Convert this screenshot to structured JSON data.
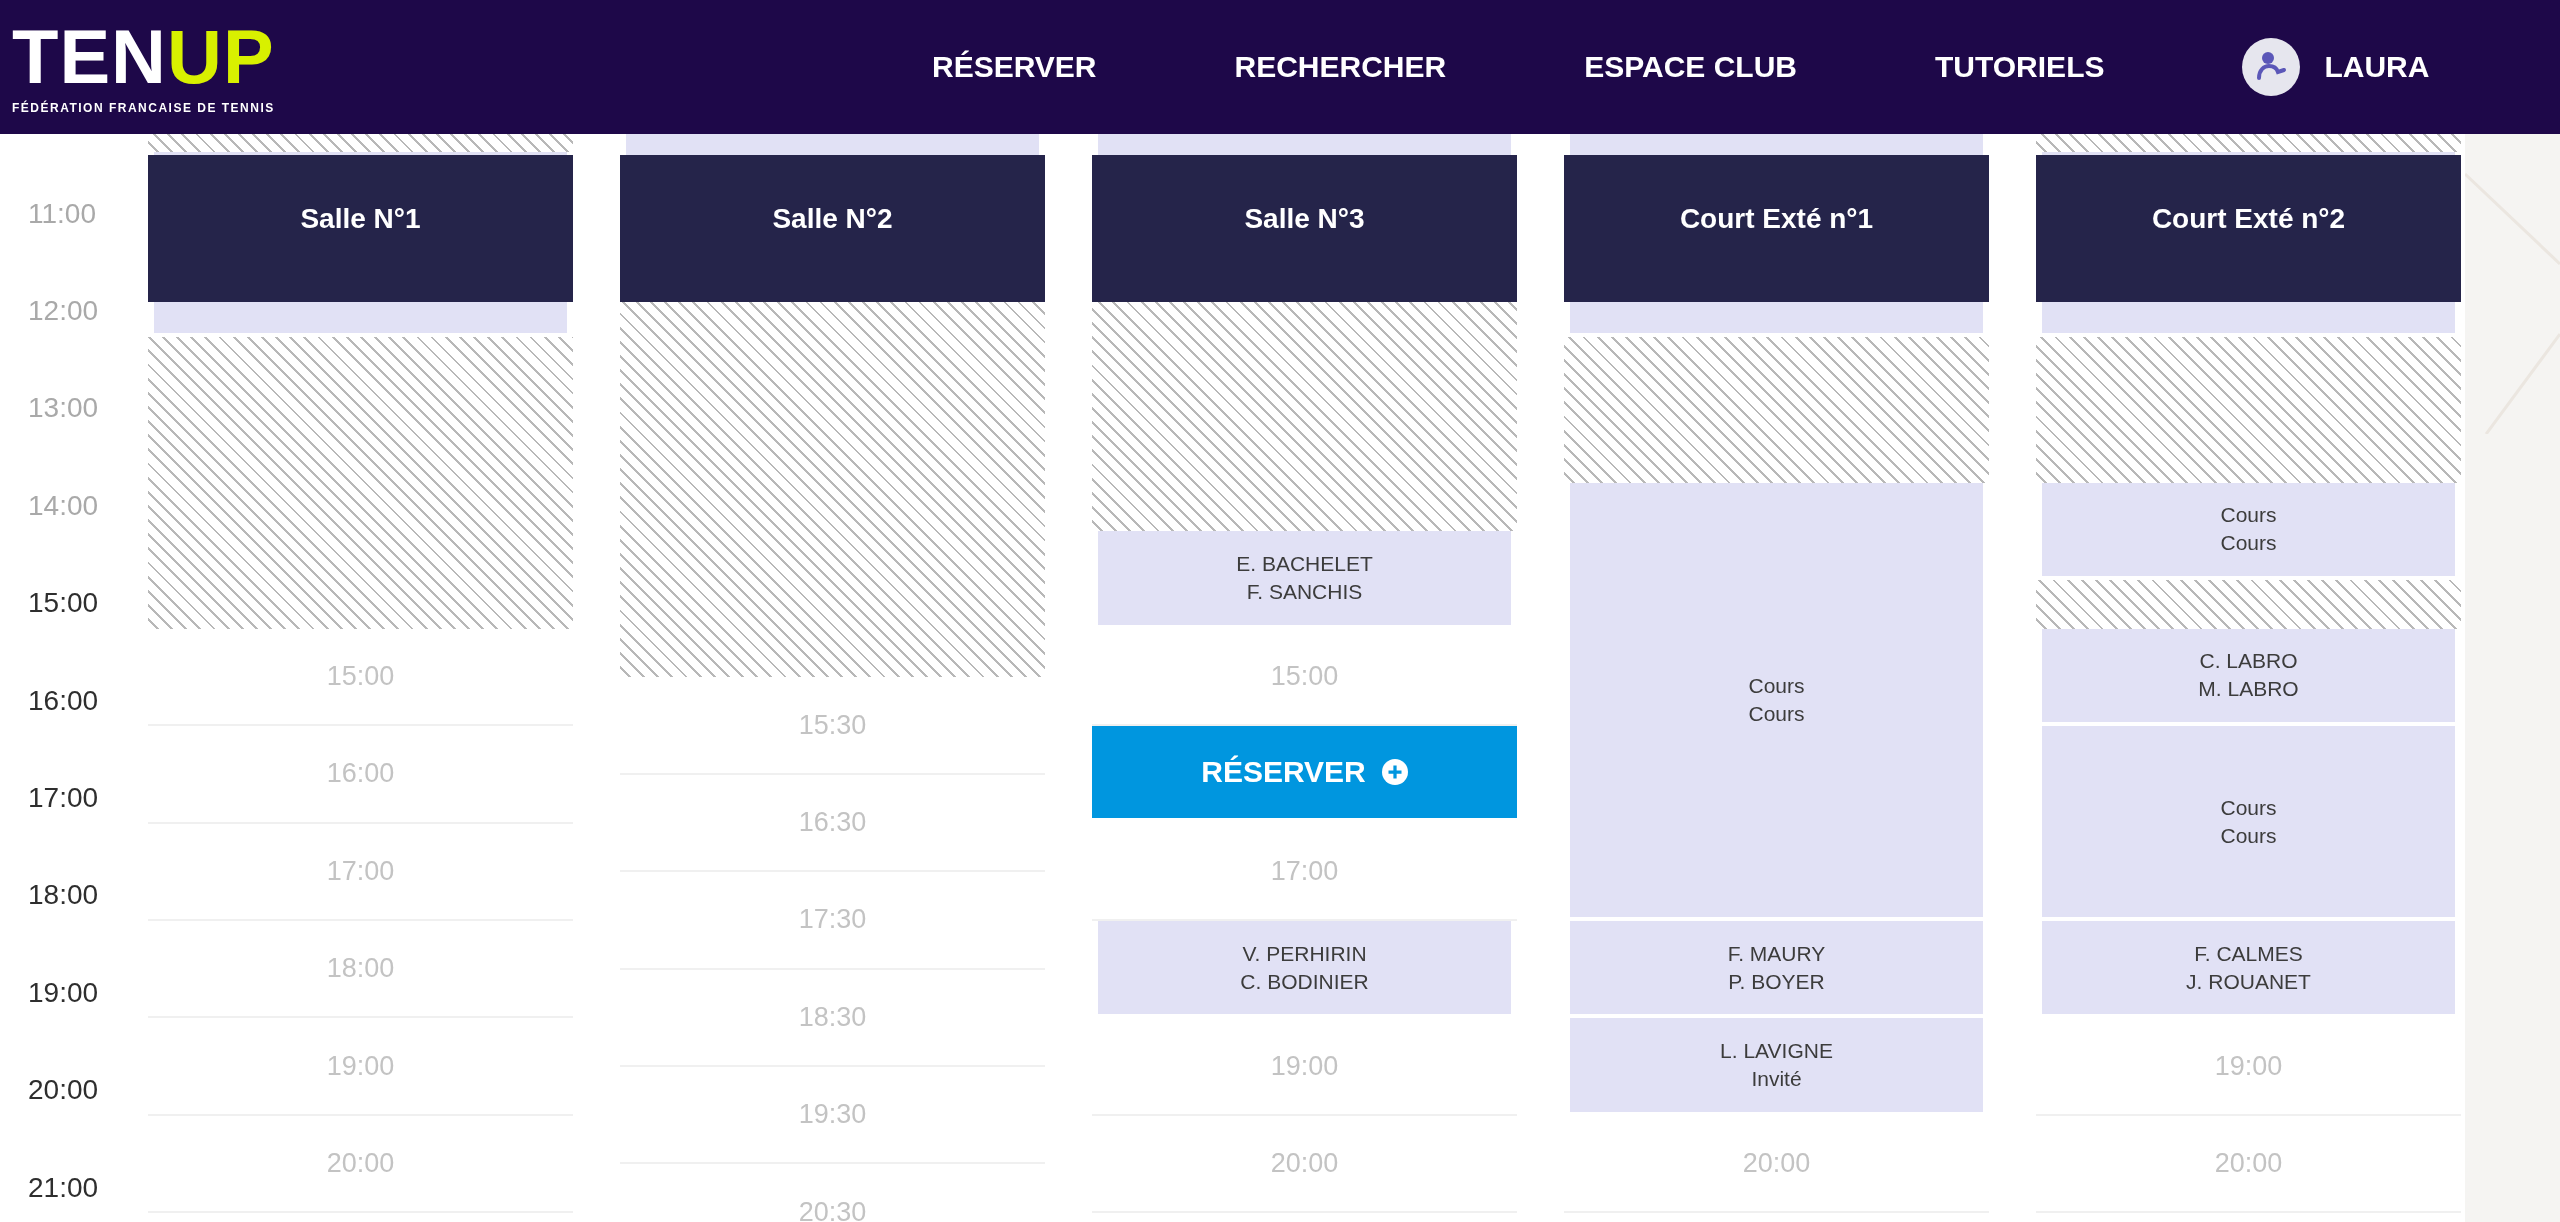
{
  "header": {
    "logo": {
      "part_1": "TEN",
      "part_2": "UP",
      "tagline": "FÉDÉRATION FRANCAISE DE TENNIS"
    },
    "nav": [
      "RÉSERVER",
      "RECHERCHER",
      "ESPACE CLUB",
      "TUTORIELS"
    ],
    "user": {
      "name": "LAURA"
    }
  },
  "axis": [
    {
      "time": "11:00",
      "past": true
    },
    {
      "time": "12:00",
      "past": true
    },
    {
      "time": "13:00",
      "past": true
    },
    {
      "time": "14:00",
      "past": true
    },
    {
      "time": "15:00",
      "past": false
    },
    {
      "time": "16:00",
      "past": false
    },
    {
      "time": "17:00",
      "past": false
    },
    {
      "time": "18:00",
      "past": false
    },
    {
      "time": "19:00",
      "past": false
    },
    {
      "time": "20:00",
      "past": false
    },
    {
      "time": "21:00",
      "past": false
    }
  ],
  "courts": [
    {
      "name": "Salle N°1",
      "blocks": [
        {
          "kind": "unavailable"
        },
        {
          "kind": "booking"
        },
        {
          "kind": "unavailable"
        },
        {
          "kind": "slot",
          "label": "15:00"
        },
        {
          "kind": "slot",
          "label": "16:00"
        },
        {
          "kind": "slot",
          "label": "17:00"
        },
        {
          "kind": "slot",
          "label": "18:00"
        },
        {
          "kind": "slot",
          "label": "19:00"
        },
        {
          "kind": "slot",
          "label": "20:00"
        }
      ]
    },
    {
      "name": "Salle N°2",
      "blocks": [
        {
          "kind": "booking"
        },
        {
          "kind": "unavailable"
        },
        {
          "kind": "slot",
          "label": "15:30"
        },
        {
          "kind": "slot",
          "label": "16:30"
        },
        {
          "kind": "slot",
          "label": "17:30"
        },
        {
          "kind": "slot",
          "label": "18:30"
        },
        {
          "kind": "slot",
          "label": "19:30"
        },
        {
          "kind": "slot",
          "label": "20:30"
        }
      ]
    },
    {
      "name": "Salle N°3",
      "blocks": [
        {
          "kind": "booking"
        },
        {
          "kind": "unavailable"
        },
        {
          "kind": "booking",
          "lines": [
            "E. BACHELET",
            "F. SANCHIS"
          ]
        },
        {
          "kind": "slot",
          "label": "15:00"
        },
        {
          "kind": "reserve",
          "label": "RÉSERVER"
        },
        {
          "kind": "slot",
          "label": "17:00"
        },
        {
          "kind": "booking",
          "lines": [
            "V. PERHIRIN",
            "C. BODINIER"
          ]
        },
        {
          "kind": "slot",
          "label": "19:00"
        },
        {
          "kind": "slot",
          "label": "20:00"
        }
      ]
    },
    {
      "name": "Court Exté n°1",
      "blocks": [
        {
          "kind": "booking"
        },
        {
          "kind": "unavailable"
        },
        {
          "kind": "booking",
          "lines": [
            "Cours",
            "Cours"
          ]
        },
        {
          "kind": "booking",
          "lines": [
            "F. MAURY",
            "P. BOYER"
          ]
        },
        {
          "kind": "booking",
          "lines": [
            "L. LAVIGNE",
            "Invité"
          ]
        },
        {
          "kind": "slot",
          "label": "20:00"
        }
      ]
    },
    {
      "name": "Court Exté n°2",
      "blocks": [
        {
          "kind": "unavailable"
        },
        {
          "kind": "booking"
        },
        {
          "kind": "unavailable"
        },
        {
          "kind": "booking",
          "lines": [
            "Cours",
            "Cours"
          ]
        },
        {
          "kind": "unavailable"
        },
        {
          "kind": "booking",
          "lines": [
            "C. LABRO",
            "M. LABRO"
          ]
        },
        {
          "kind": "booking",
          "lines": [
            "Cours",
            "Cours"
          ]
        },
        {
          "kind": "booking",
          "lines": [
            "F. CALMES",
            "J. ROUANET"
          ]
        },
        {
          "kind": "slot",
          "label": "19:00"
        },
        {
          "kind": "slot",
          "label": "20:00"
        }
      ]
    }
  ]
}
